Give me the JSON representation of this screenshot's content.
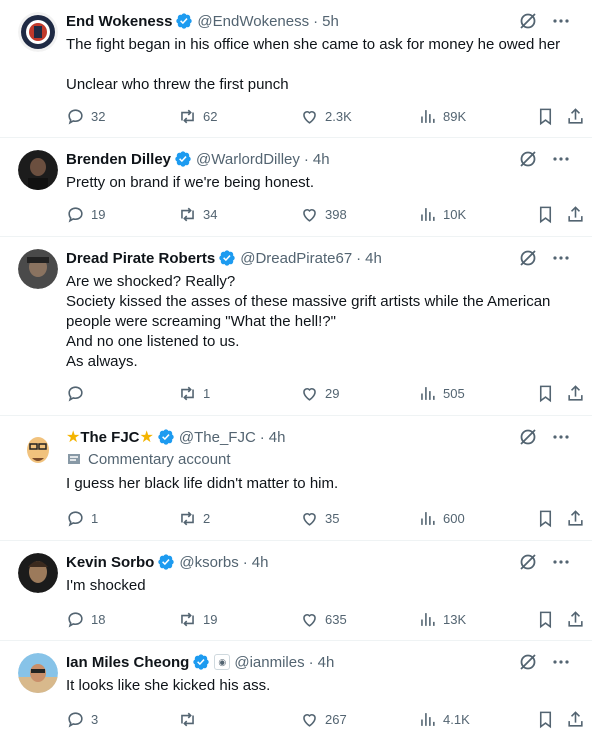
{
  "tweets": [
    {
      "name": "End Wokeness",
      "handle": "@EndWokeness",
      "sep": "·",
      "time": "5h",
      "text": "The fight began in his office when she came to ask for money he owed her\n\nUnclear who threw the first punch",
      "replies": "32",
      "reposts": "62",
      "likes": "2.3K",
      "views": "89K",
      "avatar_color": "#1f2a44"
    },
    {
      "name": "Brenden Dilley",
      "handle": "@WarlordDilley",
      "sep": "·",
      "time": "4h",
      "text": "Pretty on brand if we're being honest.",
      "replies": "19",
      "reposts": "34",
      "likes": "398",
      "views": "10K",
      "avatar_color": "#2b2b2b"
    },
    {
      "name": "Dread Pirate Roberts",
      "handle": "@DreadPirate67",
      "sep": "·",
      "time": "4h",
      "text": "Are we shocked? Really?\nSociety kissed the asses of these massive grift artists while the American people were screaming \"What the hell!?\"\nAnd no one listened to us.\nAs always.",
      "replies": "",
      "reposts": "1",
      "likes": "29",
      "views": "505",
      "avatar_color": "#3a3a3a"
    },
    {
      "name": "The FJC",
      "handle": "@The_FJC",
      "sep": "·",
      "time": "4h",
      "label": "Commentary account",
      "text": "I guess her black life didn't matter to him.",
      "replies": "1",
      "reposts": "2",
      "likes": "35",
      "views": "600",
      "avatar_color": "#e8e8e8"
    },
    {
      "name": "Kevin Sorbo",
      "handle": "@ksorbs",
      "sep": "·",
      "time": "4h",
      "text": "I'm shocked",
      "replies": "18",
      "reposts": "19",
      "likes": "635",
      "views": "13K",
      "avatar_color": "#2a2520"
    },
    {
      "name": "Ian Miles Cheong",
      "handle": "@ianmiles",
      "sep": "·",
      "time": "4h",
      "text": "It looks like she kicked his ass.",
      "replies": "3",
      "reposts": "",
      "likes": "267",
      "views": "4.1K",
      "avatar_color": "#c9a27a"
    }
  ],
  "colors": {
    "verified": "#1d9bf0",
    "muted": "#536471",
    "text": "#0f1419",
    "divider": "#eff3f4"
  },
  "icons": [
    "verified-badge-icon",
    "grok-icon",
    "more-icon",
    "reply-icon",
    "repost-icon",
    "like-icon",
    "views-icon",
    "bookmark-icon",
    "share-icon",
    "star-icon",
    "commentary-label-icon",
    "affiliate-badge-icon"
  ]
}
